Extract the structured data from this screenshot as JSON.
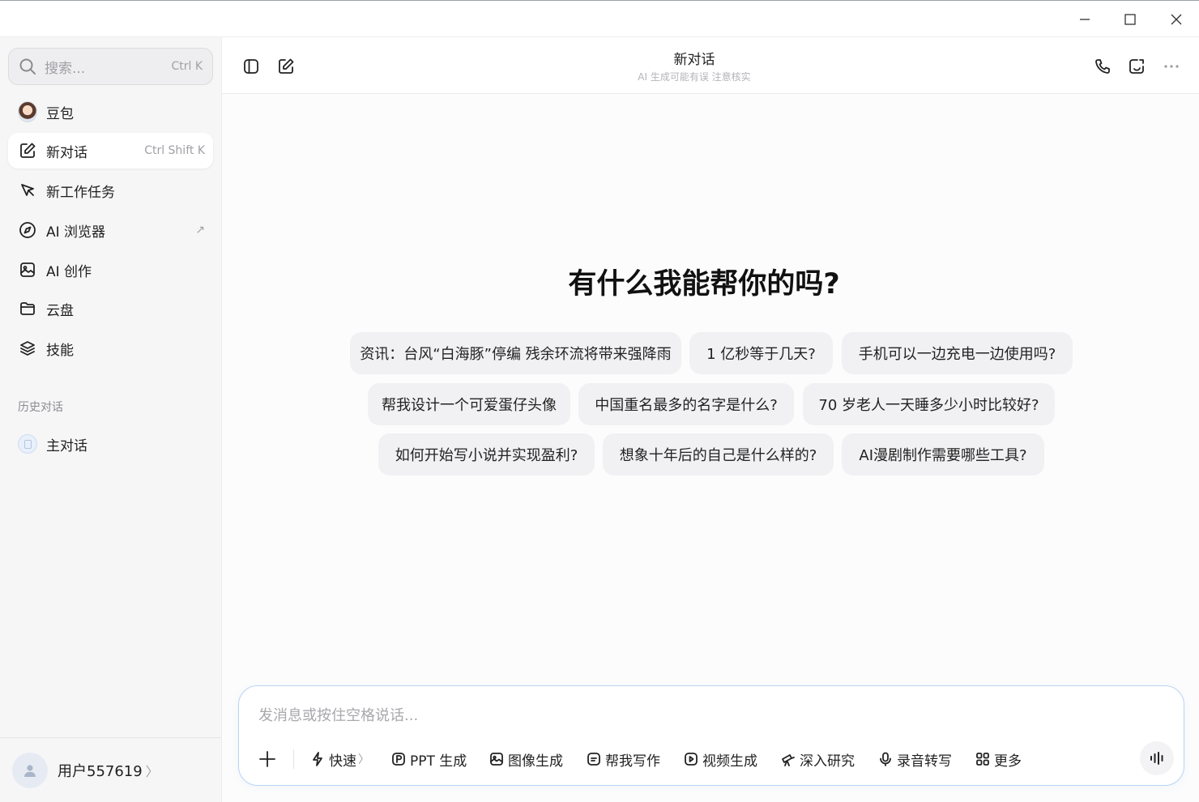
{
  "window": {
    "controls": [
      "minimize-icon",
      "maximize-icon",
      "close-icon"
    ]
  },
  "sidebar": {
    "search": {
      "placeholder": "搜索...",
      "shortcut": "Ctrl K"
    },
    "items": [
      {
        "label": "豆包",
        "icon": "doubao-avatar",
        "hint": ""
      },
      {
        "label": "新对话",
        "icon": "compose-icon",
        "hint": "Ctrl Shift K",
        "active": true
      },
      {
        "label": "新工作任务",
        "icon": "task-icon",
        "hint": ""
      },
      {
        "label": "AI 浏览器",
        "icon": "compass-icon",
        "hint": "↗"
      },
      {
        "label": "AI 创作",
        "icon": "image-icon",
        "hint": ""
      },
      {
        "label": "云盘",
        "icon": "folder-icon",
        "hint": ""
      },
      {
        "label": "技能",
        "icon": "layers-icon",
        "hint": ""
      }
    ],
    "history_label": "历史对话",
    "history": [
      {
        "label": "主对话"
      }
    ],
    "user": {
      "name": "用户557619",
      "chevron": "〉"
    }
  },
  "header": {
    "title": "新对话",
    "subtitle": "AI 生成可能有误 注意核实"
  },
  "main": {
    "headline": "有什么我能帮你的吗?",
    "suggestions": [
      "资讯：台风“白海豚”停编 残余环流将带来强降雨",
      "1 亿秒等于几天?",
      "手机可以一边充电一边使用吗?",
      "帮我设计一个可爱蛋仔头像",
      "中国重名最多的名字是什么?",
      "70 岁老人一天睡多少小时比较好?",
      "如何开始写小说并实现盈利?",
      "想象十年后的自己是什么样的?",
      "AI漫剧制作需要哪些工具?"
    ]
  },
  "composer": {
    "placeholder": "发消息或按住空格说话...",
    "tools": [
      {
        "label": "快速",
        "suffix": "〉",
        "icon": "lightning-icon"
      },
      {
        "label": "PPT 生成",
        "icon": "ppt-icon"
      },
      {
        "label": "图像生成",
        "icon": "image-icon"
      },
      {
        "label": "帮我写作",
        "icon": "writing-icon"
      },
      {
        "label": "视频生成",
        "icon": "video-icon"
      },
      {
        "label": "深入研究",
        "icon": "telescope-icon"
      },
      {
        "label": "录音转写",
        "icon": "microphone-icon"
      },
      {
        "label": "更多",
        "icon": "grid-icon"
      }
    ]
  }
}
